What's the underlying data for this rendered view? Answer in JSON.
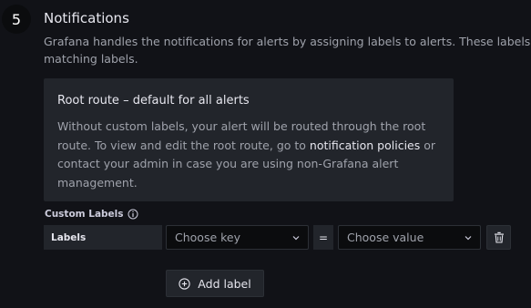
{
  "section": {
    "step_number": "5",
    "title": "Notifications",
    "description": "Grafana handles the notifications for alerts by assigning labels to alerts. These labels co matching labels."
  },
  "root_route": {
    "title": "Root route – default for all alerts",
    "text_before_link": "Without custom labels, your alert will be routed through the root route. To view and edit the root route, go to ",
    "link": "notification policies",
    "text_after_link": " or contact your admin in case you are using non-Grafana alert management."
  },
  "custom_labels": {
    "label": "Custom Labels",
    "row_label": "Labels",
    "key_placeholder": "Choose key",
    "operator": "=",
    "value_placeholder": "Choose value",
    "add_button": "Add label"
  },
  "icons": {
    "info": "info-circle-icon",
    "chevron": "chevron-down-icon",
    "trash": "trash-icon",
    "add": "plus-circle-icon"
  }
}
